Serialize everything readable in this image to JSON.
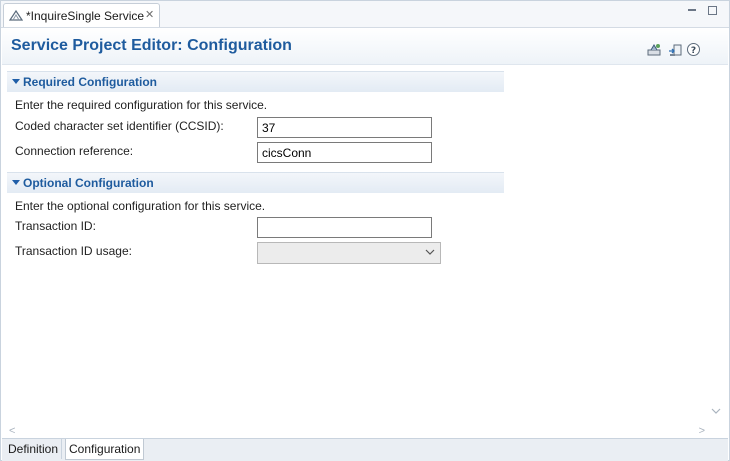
{
  "editor_tab": {
    "label": "*InquireSingle Service",
    "close_glyph": "✕"
  },
  "page": {
    "title": "Service Project Editor: Configuration"
  },
  "header_icons": [
    "deploy-icon",
    "export-icon",
    "help-icon"
  ],
  "sections": {
    "required": {
      "title": "Required Configuration",
      "description": "Enter the required configuration for this service.",
      "ccsid_label": "Coded character set identifier (CCSID):",
      "ccsid_value": "37",
      "connection_label": "Connection reference:",
      "connection_value": "cicsConn"
    },
    "optional": {
      "title": "Optional Configuration",
      "description": "Enter the optional configuration for this service.",
      "transaction_id_label": "Transaction ID:",
      "transaction_id_value": "",
      "transaction_usage_label": "Transaction ID usage:",
      "transaction_usage_value": ""
    }
  },
  "bottom_tabs": [
    "Definition",
    "Configuration"
  ],
  "active_bottom_tab": "Configuration",
  "colors": {
    "title": "#1e5b9e",
    "section_bg": "#e3ebf4",
    "tab_bar": "#f5f7fa"
  }
}
